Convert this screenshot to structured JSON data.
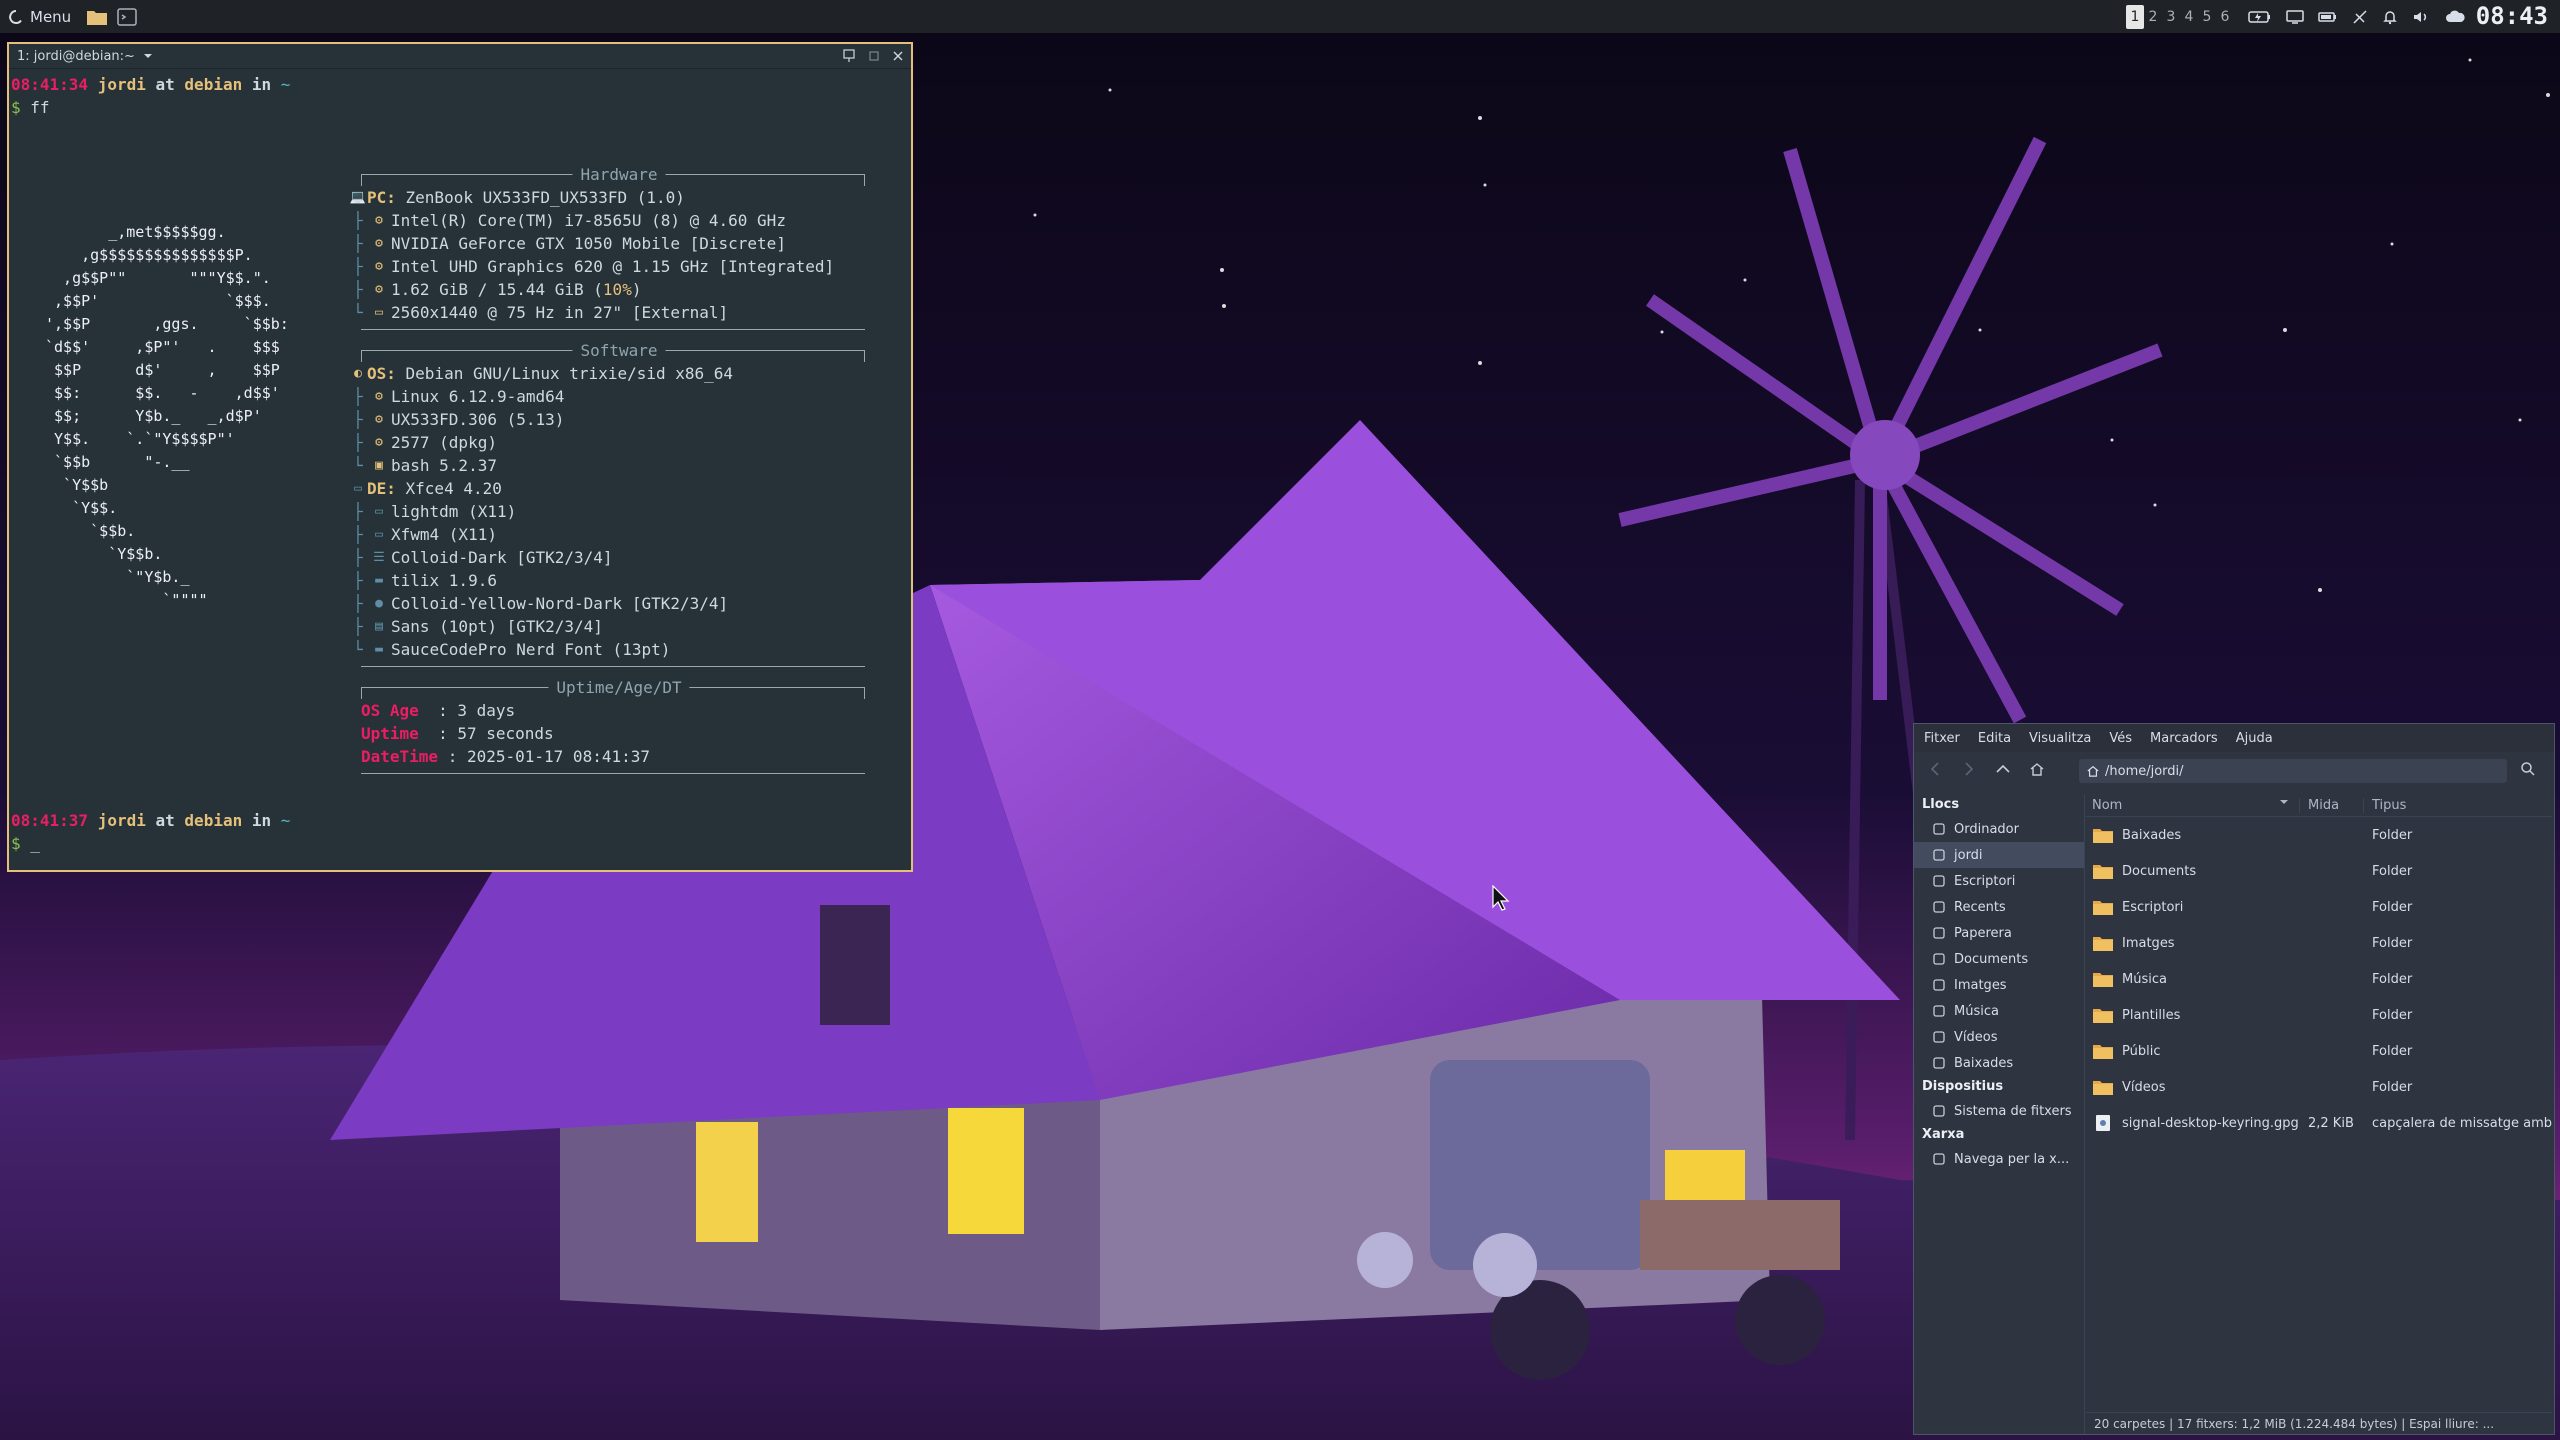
{
  "colors": {
    "panel_bg": "#1f2227",
    "terminal_bg": "#263238",
    "terminal_border": "#e5c07b",
    "accent_pink": "#e91e63",
    "accent_yellow": "#e5c07b",
    "filemanager_bg": "#2e3440",
    "sky_top": "#0c0818",
    "sky_horizon": "#b0338f",
    "house_roof": "#8b3fcf"
  },
  "panel": {
    "menu_label": "Menu",
    "workspaces": [
      "1",
      "2",
      "3",
      "4",
      "5",
      "6"
    ],
    "active_workspace": "1",
    "clock": "08:43",
    "tray_icons": [
      "battery-charging-icon",
      "display-icon",
      "battery-icon",
      "network-off-icon",
      "bell-icon",
      "volume-icon",
      "cloud-icon"
    ]
  },
  "terminal": {
    "title": "1: jordi@debian:~",
    "prompt1": {
      "time": "08:41:34",
      "user": "jordi",
      "at": "at",
      "host": "debian",
      "in": "in",
      "dir": "~"
    },
    "command": "ff",
    "prompt_symbol": "$",
    "ascii_art": [
      "       _,met$$$$$gg.",
      "    ,g$$$$$$$$$$$$$$$P.",
      "  ,g$$P\"\"       \"\"\"Y$$.\".",
      " ,$$P'              `$$$.",
      "',$$P       ,ggs.     `$$b:",
      "`d$$'     ,$P\"'   .    $$$",
      " $$P      d$'     ,    $$P",
      " $$:      $$.   -    ,d$$'",
      " $$;      Y$b._   _,d$P'",
      " Y$$.    `.`\"Y$$$$P\"'",
      " `$$b      \"-.__",
      "  `Y$$b",
      "   `Y$$.",
      "     `$$b.",
      "       `Y$$b.",
      "         `\"Y$b._",
      "             `\"\"\"\""
    ],
    "hardware": {
      "header": "Hardware",
      "pc_key": "PC",
      "pc": "ZenBook UX533FD_UX533FD (1.0)",
      "cpu": "Intel(R) Core(TM) i7-8565U (8) @ 4.60 GHz",
      "gpu1": "NVIDIA GeForce GTX 1050 Mobile [Discrete]",
      "gpu2": "Intel UHD Graphics 620 @ 1.15 GHz [Integrated]",
      "memory": "1.62 GiB / 15.44 GiB",
      "memory_pct": "10%",
      "display": "2560x1440 @ 75 Hz in 27\" [External]"
    },
    "software": {
      "header": "Software",
      "os_key": "OS",
      "os": "Debian GNU/Linux trixie/sid x86_64",
      "kernel": "Linux 6.12.9-amd64",
      "bios": "UX533FD.306 (5.13)",
      "packages": "2577 (dpkg)",
      "shell": "bash 5.2.37",
      "de_key": "DE",
      "de": "Xfce4 4.20",
      "lm": "lightdm (X11)",
      "wm": "Xfwm4 (X11)",
      "wm_theme": "Colloid-Dark [GTK2/3/4]",
      "terminal": "tilix 1.9.6",
      "icons": "Colloid-Yellow-Nord-Dark [GTK2/3/4]",
      "font": "Sans (10pt) [GTK2/3/4]",
      "term_font": "SauceCodePro Nerd Font (13pt)"
    },
    "uptime": {
      "header": "Uptime/Age/DT",
      "os_age_key": "OS Age",
      "os_age": "3 days",
      "uptime_key": "Uptime",
      "uptime": "57 seconds",
      "datetime_key": "DateTime",
      "datetime": "2025-01-17 08:41:37"
    },
    "prompt2": {
      "time": "08:41:37",
      "user": "jordi",
      "at": "at",
      "host": "debian",
      "in": "in",
      "dir": "~"
    },
    "cursor": "_"
  },
  "filemanager": {
    "menu": [
      "Fitxer",
      "Edita",
      "Visualitza",
      "Vés",
      "Marcadors",
      "Ajuda"
    ],
    "path": "/home/jordi/",
    "sidebar": {
      "places_header": "Llocs",
      "places": [
        {
          "label": "Ordinador",
          "icon": "computer-icon"
        },
        {
          "label": "jordi",
          "icon": "home-icon",
          "active": true
        },
        {
          "label": "Escriptori",
          "icon": "desktop-icon"
        },
        {
          "label": "Recents",
          "icon": "clock-icon"
        },
        {
          "label": "Paperera",
          "icon": "trash-icon"
        },
        {
          "label": "Documents",
          "icon": "document-icon"
        },
        {
          "label": "Imatges",
          "icon": "image-icon"
        },
        {
          "label": "Música",
          "icon": "music-icon"
        },
        {
          "label": "Vídeos",
          "icon": "video-icon"
        },
        {
          "label": "Baixades",
          "icon": "download-icon"
        }
      ],
      "devices_header": "Dispositius",
      "devices": [
        {
          "label": "Sistema de fitxers",
          "icon": "drive-icon"
        }
      ],
      "network_header": "Xarxa",
      "network": [
        {
          "label": "Navega per la x...",
          "icon": "network-icon"
        }
      ]
    },
    "columns": {
      "name": "Nom",
      "size": "Mida",
      "type": "Tipus"
    },
    "files": [
      {
        "name": "Baixades",
        "size": "",
        "type": "Folder",
        "kind": "folder"
      },
      {
        "name": "Documents",
        "size": "",
        "type": "Folder",
        "kind": "folder"
      },
      {
        "name": "Escriptori",
        "size": "",
        "type": "Folder",
        "kind": "folder"
      },
      {
        "name": "Imatges",
        "size": "",
        "type": "Folder",
        "kind": "folder"
      },
      {
        "name": "Música",
        "size": "",
        "type": "Folder",
        "kind": "folder"
      },
      {
        "name": "Plantilles",
        "size": "",
        "type": "Folder",
        "kind": "folder"
      },
      {
        "name": "Públic",
        "size": "",
        "type": "Folder",
        "kind": "folder"
      },
      {
        "name": "Vídeos",
        "size": "",
        "type": "Folder",
        "kind": "folder"
      },
      {
        "name": "signal-desktop-keyring.gpg",
        "size": "2,2 KiB",
        "type": "capçalera de missatge amb",
        "kind": "file"
      }
    ],
    "status": "20 carpetes  |  17 fitxers: 1,2 MiB (1.224.484 bytes)  |  Espai lliure: ..."
  }
}
